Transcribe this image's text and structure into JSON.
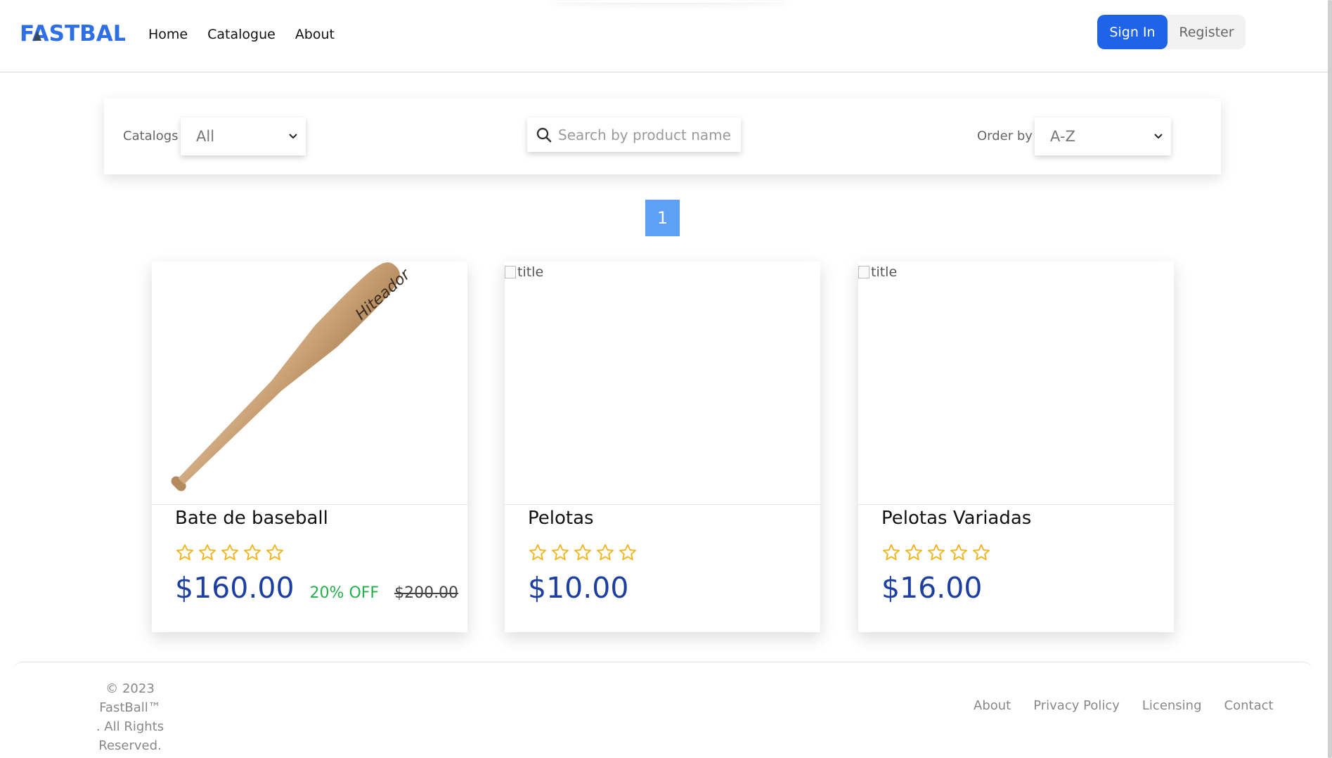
{
  "header": {
    "logo_text": "FASTBALL",
    "nav": [
      {
        "label": "Home"
      },
      {
        "label": "Catalogue"
      },
      {
        "label": "About"
      }
    ],
    "sign_in_label": "Sign In",
    "register_label": "Register",
    "brand_color": "#2f6fe4"
  },
  "filters": {
    "catalogs_label": "Catalogs",
    "catalogs_value": "All",
    "search_placeholder": "Search by product name",
    "order_label": "Order by",
    "order_value": "A-Z"
  },
  "pagination": {
    "current_page": "1"
  },
  "products": [
    {
      "title": "Bate de baseball",
      "image_text": "Hiteador",
      "rating": 0,
      "price": "$160.00",
      "discount": "20% OFF",
      "old_price": "$200.00"
    },
    {
      "title": "Pelotas",
      "image_alt": "title",
      "rating": 0,
      "price": "$10.00"
    },
    {
      "title": "Pelotas Variadas",
      "image_alt": "title",
      "rating": 0,
      "price": "$16.00"
    }
  ],
  "footer": {
    "copyright_line1": "© 2023",
    "copyright_line2": "FastBall™",
    "copyright_line3": ". All Rights Reserved.",
    "links": [
      {
        "label": "About"
      },
      {
        "label": "Privacy Policy"
      },
      {
        "label": "Licensing"
      },
      {
        "label": "Contact"
      }
    ]
  },
  "colors": {
    "primary": "#1f63e8",
    "price": "#1d3fa0",
    "discount": "#26b04b",
    "star": "#f5b31b",
    "page_active": "#5ea0f4"
  }
}
